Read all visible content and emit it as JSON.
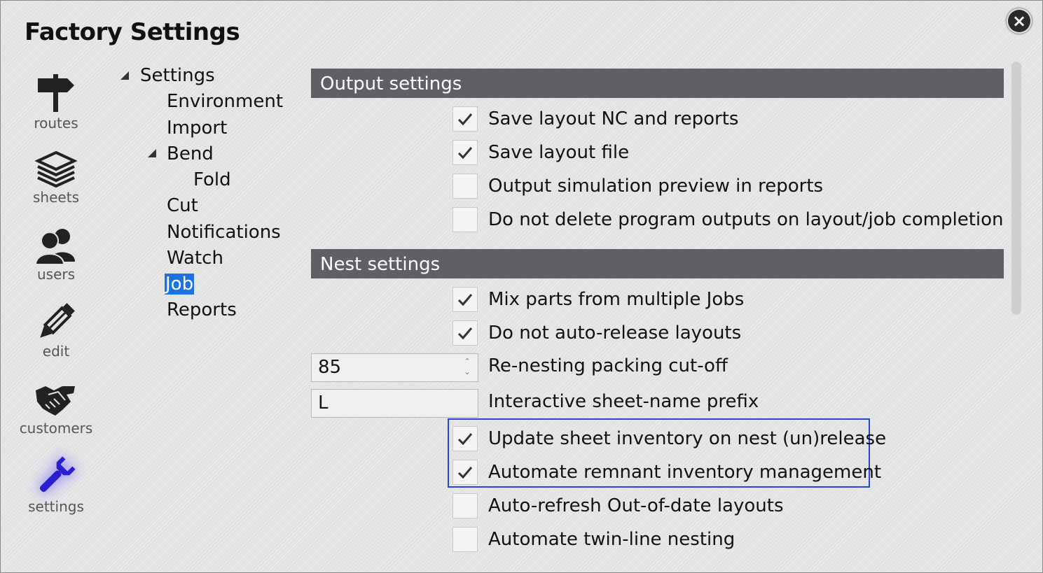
{
  "window": {
    "title": "Factory Settings",
    "close_icon": "close-icon"
  },
  "nav": [
    {
      "label": "routes",
      "icon": "signpost-icon"
    },
    {
      "label": "sheets",
      "icon": "stack-icon"
    },
    {
      "label": "users",
      "icon": "users-icon"
    },
    {
      "label": "edit",
      "icon": "pencil-icon"
    },
    {
      "label": "customers",
      "icon": "handshake-icon"
    },
    {
      "label": "settings",
      "icon": "wrench-icon",
      "active": true
    }
  ],
  "tree": {
    "root": "Settings",
    "items": [
      "Environment",
      "Import",
      "Bend",
      "Fold",
      "Cut",
      "Notifications",
      "Watch",
      "Job",
      "Reports"
    ],
    "selected": "Job"
  },
  "output_settings": {
    "header": "Output settings",
    "options": [
      {
        "label": "Save layout NC and reports",
        "checked": true
      },
      {
        "label": "Save layout file",
        "checked": true
      },
      {
        "label": "Output simulation preview in reports",
        "checked": false
      },
      {
        "label": "Do not delete program outputs on layout/job completion",
        "checked": false
      }
    ]
  },
  "nest_settings": {
    "header": "Nest settings",
    "options": [
      {
        "label": "Mix parts from multiple Jobs",
        "checked": true
      },
      {
        "label": "Do not auto-release layouts",
        "checked": true
      }
    ],
    "repacking": {
      "value": "85",
      "label": "Re-nesting packing cut-off"
    },
    "prefix": {
      "value": "L",
      "label": "Interactive sheet-name prefix"
    },
    "highlighted_options": [
      {
        "label": "Update sheet inventory on nest (un)release",
        "checked": true
      },
      {
        "label": "Automate remnant inventory management",
        "checked": true
      }
    ],
    "more_options": [
      {
        "label": "Auto-refresh Out-of-date layouts",
        "checked": false
      },
      {
        "label": "Automate twin-line nesting",
        "checked": false
      }
    ]
  },
  "colors": {
    "header_bg": "#5f6066",
    "selection": "#1a73e0",
    "highlight_border": "#2447d4"
  }
}
